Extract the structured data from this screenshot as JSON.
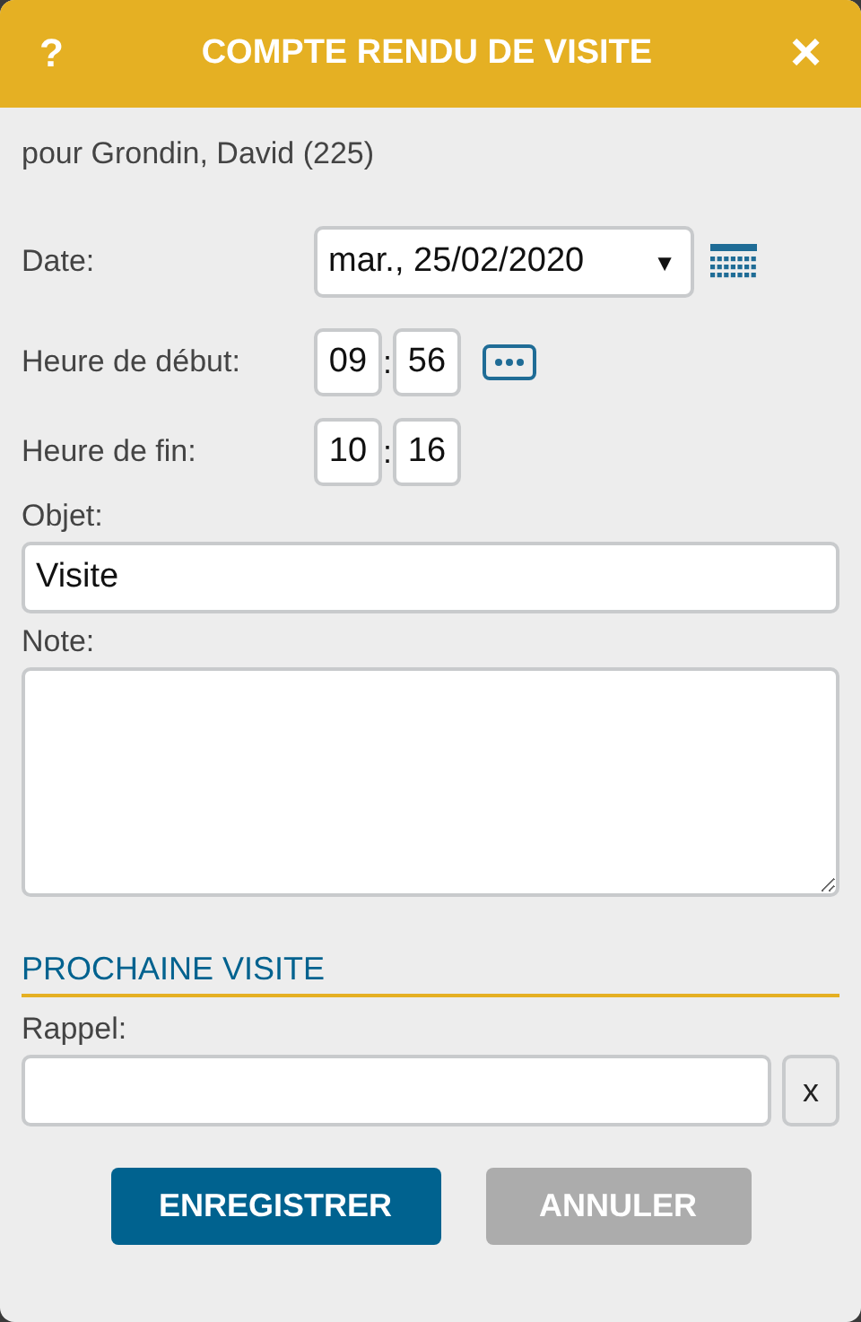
{
  "header": {
    "help": "?",
    "title": "COMPTE RENDU DE VISITE",
    "close": "×"
  },
  "subtitle": "pour Grondin, David (225)",
  "date": {
    "label": "Date:",
    "value": "mar., 25/02/2020",
    "caret": "▼"
  },
  "start": {
    "label": "Heure de début:",
    "hour": "09",
    "separator": ":",
    "minute": "56"
  },
  "end": {
    "label": "Heure de fin:",
    "hour": "10",
    "separator": ":",
    "minute": "16"
  },
  "subject": {
    "label": "Objet:",
    "value": "Visite"
  },
  "note": {
    "label": "Note:"
  },
  "next_visit": {
    "title": "PROCHAINE VISITE",
    "label": "Rappel:",
    "clear": "x"
  },
  "buttons": [
    {
      "label": "ENREGISTRER",
      "kind": "primary"
    },
    {
      "label": "ANNULER",
      "kind": "secondary"
    }
  ]
}
